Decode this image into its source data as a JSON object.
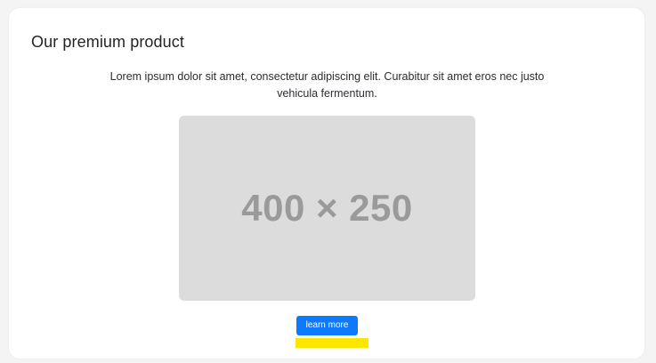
{
  "card": {
    "title": "Our premium product",
    "description": "Lorem ipsum dolor sit amet, consectetur adipiscing elit. Curabitur sit amet eros nec justo vehicula fermentum.",
    "image_placeholder_text": "400 × 250",
    "button_label": "learn more"
  },
  "colors": {
    "button": "#0d79ff",
    "highlight": "#ffe600",
    "placeholder_bg": "#dcdcdc",
    "placeholder_text": "#9a9a9a"
  }
}
